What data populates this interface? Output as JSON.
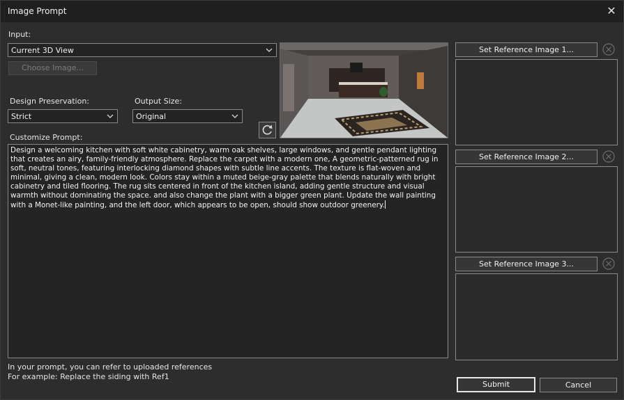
{
  "window": {
    "title": "Image Prompt",
    "close_glyph": "✕"
  },
  "input": {
    "label": "Input:",
    "selected": "Current 3D View",
    "choose_image_label": "Choose Image..."
  },
  "design_preservation": {
    "label": "Design Preservation:",
    "selected": "Strict"
  },
  "output_size": {
    "label": "Output Size:",
    "selected": "Original"
  },
  "prompt": {
    "label": "Customize Prompt:",
    "text": "Design a welcoming kitchen with soft white cabinetry, warm oak shelves, large windows, and gentle pendant lighting that creates an airy, family-friendly atmosphere. Replace the carpet with a modern one, A geometric-patterned rug in soft, neutral tones, featuring interlocking diamond shapes with subtle line accents. The texture is flat-woven and minimal, giving a clean, modern look. Colors stay within a muted beige-gray palette that blends naturally with bright cabinetry and tiled flooring. The rug sits centered in front of the kitchen island, adding gentle structure and visual warmth without dominating the space. and also change the plant with a bigger green plant. Update the wall painting with a Monet-like painting, and the left door, which appears to be open, should show outdoor greenery."
  },
  "references": [
    {
      "button_label": "Set Reference Image 1..."
    },
    {
      "button_label": "Set Reference Image 2..."
    },
    {
      "button_label": "Set Reference Image 3..."
    }
  ],
  "hint": {
    "line1": "In your prompt, you can refer to uploaded references",
    "line2": "For example: Replace the siding with Ref1"
  },
  "actions": {
    "submit_label": "Submit",
    "cancel_label": "Cancel"
  },
  "icons": {
    "close": "close-icon",
    "dropdown": "chevron-down-icon",
    "refresh": "refresh-icon",
    "clear": "clear-circle-icon"
  }
}
